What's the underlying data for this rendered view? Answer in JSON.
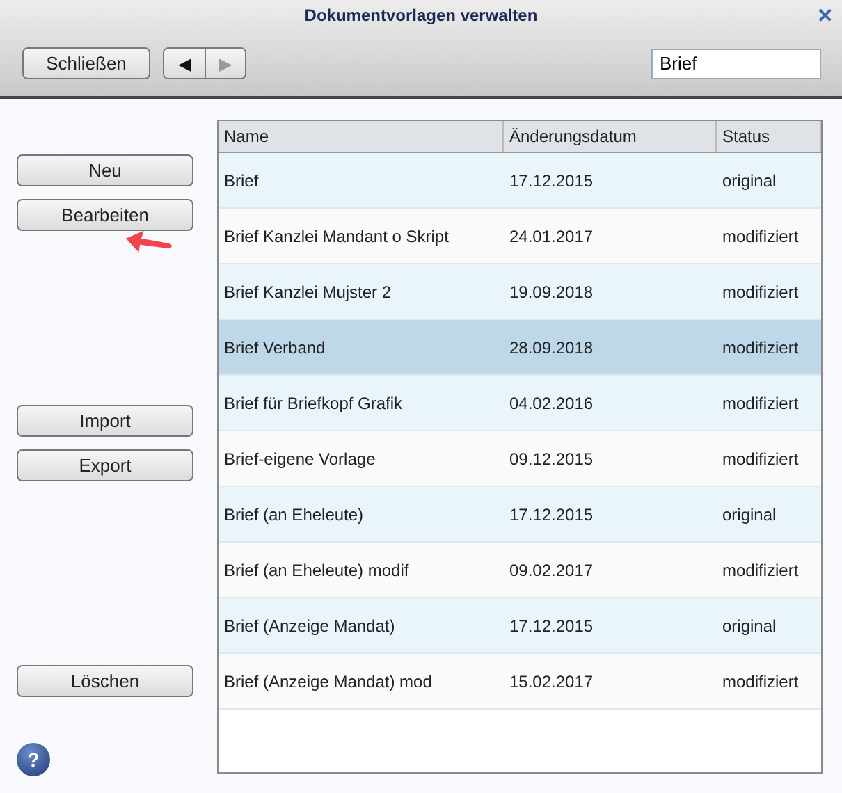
{
  "window": {
    "title": "Dokumentvorlagen verwalten",
    "close": "✕"
  },
  "toolbar": {
    "close_button": "Schließen",
    "nav": [
      {
        "label": "◀",
        "disabled": false
      },
      {
        "label": "▶",
        "disabled": true
      }
    ],
    "search": {
      "value": "Brief"
    }
  },
  "side_groups": [
    {
      "buttons": [
        "Neu",
        "Bearbeiten"
      ]
    },
    {
      "buttons": [
        "Import",
        "Export"
      ]
    },
    {
      "buttons": [
        "Löschen"
      ]
    }
  ],
  "help": "?",
  "table": {
    "columns": [
      "Name",
      "Änderungsdatum",
      "Status"
    ],
    "rows": [
      {
        "cells": [
          "Brief",
          "17.12.2015",
          "original"
        ],
        "selected": false
      },
      {
        "cells": [
          "Brief Kanzlei Mandant o Skript",
          "24.01.2017",
          "modifiziert"
        ],
        "selected": false
      },
      {
        "cells": [
          "Brief Kanzlei Mujster 2",
          "19.09.2018",
          "modifiziert"
        ],
        "selected": false
      },
      {
        "cells": [
          "Brief Verband",
          "28.09.2018",
          "modifiziert"
        ],
        "selected": true
      },
      {
        "cells": [
          "Brief für Briefkopf Grafik",
          "04.02.2016",
          "modifiziert"
        ],
        "selected": false
      },
      {
        "cells": [
          "Brief-eigene Vorlage",
          "09.12.2015",
          "modifiziert"
        ],
        "selected": false
      },
      {
        "cells": [
          "Brief (an Eheleute)",
          "17.12.2015",
          "original"
        ],
        "selected": false
      },
      {
        "cells": [
          "Brief (an Eheleute) modif",
          "09.02.2017",
          "modifiziert"
        ],
        "selected": false
      },
      {
        "cells": [
          "Brief (Anzeige Mandat)",
          "17.12.2015",
          "original"
        ],
        "selected": false
      },
      {
        "cells": [
          "Brief (Anzeige Mandat) mod",
          "15.02.2017",
          "modifiziert"
        ],
        "selected": false
      }
    ]
  }
}
